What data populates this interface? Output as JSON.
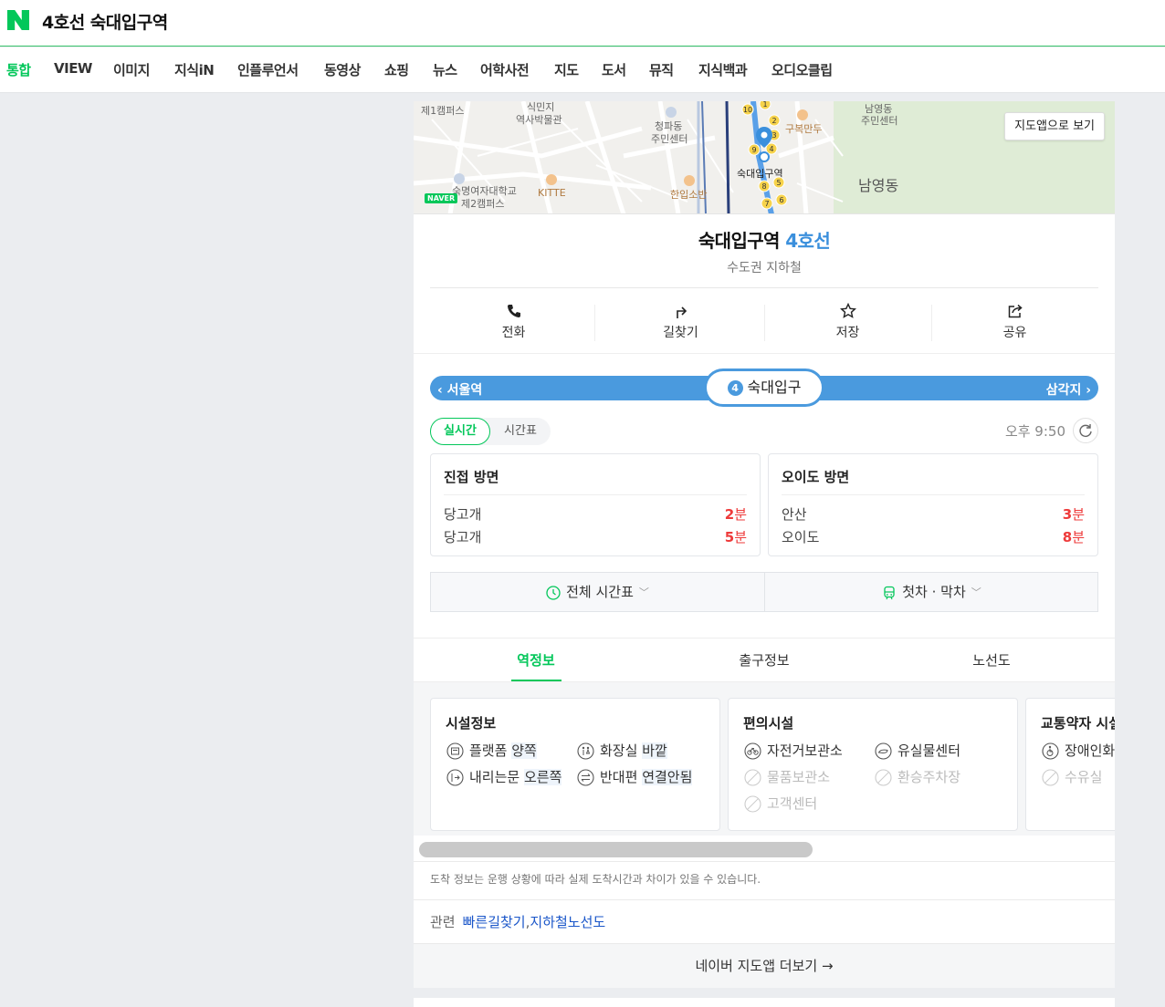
{
  "header": {
    "query": "4호선 숙대입구역"
  },
  "tabs": [
    "통합",
    "VIEW",
    "이미지",
    "지식iN",
    "인플루언서",
    "동영상",
    "쇼핑",
    "뉴스",
    "어학사전",
    "지도",
    "도서",
    "뮤직",
    "지식백과",
    "오디오클립"
  ],
  "map": {
    "open_app_label": "지도앱으로 보기",
    "labels": [
      "제1캠퍼스",
      "식민지",
      "역사박물관",
      "청파동",
      "주민센터",
      "구복만두",
      "남영동",
      "주민센터",
      "숙대입구역",
      "숙명여자대학교",
      "제2캠퍼스",
      "KITTE",
      "한입소반",
      "남영동"
    ],
    "exit_numbers": [
      "10",
      "1",
      "2",
      "3",
      "4",
      "9",
      "8",
      "5",
      "7",
      "6"
    ],
    "naver_badge": "NAVER"
  },
  "station": {
    "name": "숙대입구역",
    "line": "4호선",
    "category": "수도권 지하철"
  },
  "actions": [
    "전화",
    "길찾기",
    "저장",
    "공유"
  ],
  "linebar": {
    "prev": "서울역",
    "current_num": "4",
    "current": "숙대입구",
    "next": "삼각지",
    "color": "#4a9ade"
  },
  "realtime": {
    "toggle_on": "실시간",
    "toggle_off": "시간표",
    "time": "오후 9:50"
  },
  "directions": [
    {
      "title": "진접 방면",
      "rows": [
        {
          "dest": "당고개",
          "min": "2",
          "unit": "분"
        },
        {
          "dest": "당고개",
          "min": "5",
          "unit": "분"
        }
      ]
    },
    {
      "title": "오이도 방면",
      "rows": [
        {
          "dest": "안산",
          "min": "3",
          "unit": "분"
        },
        {
          "dest": "오이도",
          "min": "8",
          "unit": "분"
        }
      ]
    }
  ],
  "schedule": {
    "full": "전체 시간표",
    "firstlast": "첫차 · 막차"
  },
  "subtabs": [
    "역정보",
    "출구정보",
    "노선도"
  ],
  "facilities": {
    "info": {
      "title": "시설정보",
      "items": [
        {
          "label": "플랫폼",
          "value": "양쪽"
        },
        {
          "label": "화장실",
          "value": "바깥"
        },
        {
          "label": "내리는문",
          "value": "오른쪽"
        },
        {
          "label": "반대편",
          "value": "연결안됨"
        }
      ]
    },
    "convenience": {
      "title": "편의시설",
      "items": [
        "자전거보관소",
        "유실물센터",
        "물품보관소",
        "환승주차장",
        "고객센터"
      ]
    },
    "accessibility": {
      "title": "교통약자 시설",
      "items": [
        "장애인화장실",
        "수유실"
      ]
    }
  },
  "notice": "도착 정보는 운행 상황에 따라 실제 도착시간과 차이가 있을 수 있습니다.",
  "related": {
    "label": "관련",
    "links": [
      "빠른길찾기",
      "지하철노선도"
    ],
    "sep": ","
  },
  "more": "네이버 지도앱 더보기"
}
